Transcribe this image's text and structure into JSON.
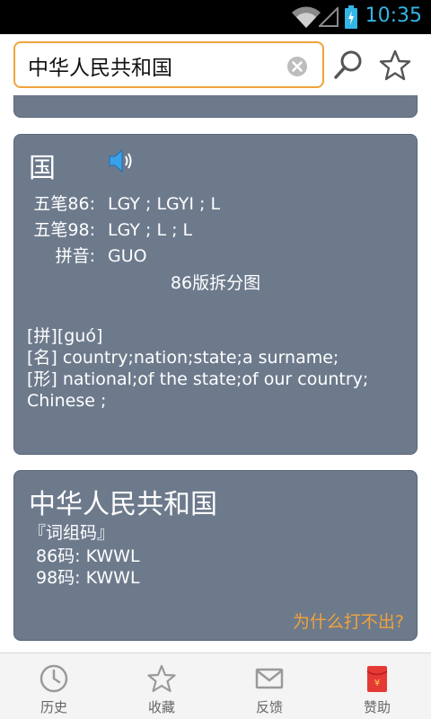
{
  "status_bar": {
    "time": "10:35",
    "icons": [
      "wifi-icon",
      "signal-icon",
      "battery-icon"
    ]
  },
  "search": {
    "value": "中华人民共和国",
    "icons": [
      "clear-icon",
      "search-icon",
      "star-icon"
    ]
  },
  "char_card": {
    "character": "国",
    "wubi86_label": "五笔86:",
    "wubi86_value": "LGY ; LGYI ; L",
    "wubi98_label": "五笔98:",
    "wubi98_value": "LGY ; L ; L",
    "pinyin_label": "拼音:",
    "pinyin_value": "GUO",
    "diagram_link": "86版拆分图",
    "definitions": [
      "[拼][guó]",
      "[名] country;nation;state;a surname;",
      "[形] national;of the state;of our country;",
      "Chinese ;"
    ]
  },
  "word_card": {
    "word": "中华人民共和国",
    "subtitle": "『词组码』",
    "code86": "86码:  KWWL",
    "code98": "98码:  KWWL",
    "why_link": "为什么打不出?"
  },
  "bottom_nav": [
    {
      "label": "历史",
      "icon": "clock-icon"
    },
    {
      "label": "收藏",
      "icon": "star-icon"
    },
    {
      "label": "反馈",
      "icon": "mail-icon"
    },
    {
      "label": "赞助",
      "icon": "red-envelope-icon"
    }
  ],
  "colors": {
    "accent": "#f0a33a",
    "card_bg": "#6d7a8c",
    "status_blue": "#33b5e5",
    "nav_icon": "#9a9a9a",
    "red_envelope": "#e53935"
  }
}
